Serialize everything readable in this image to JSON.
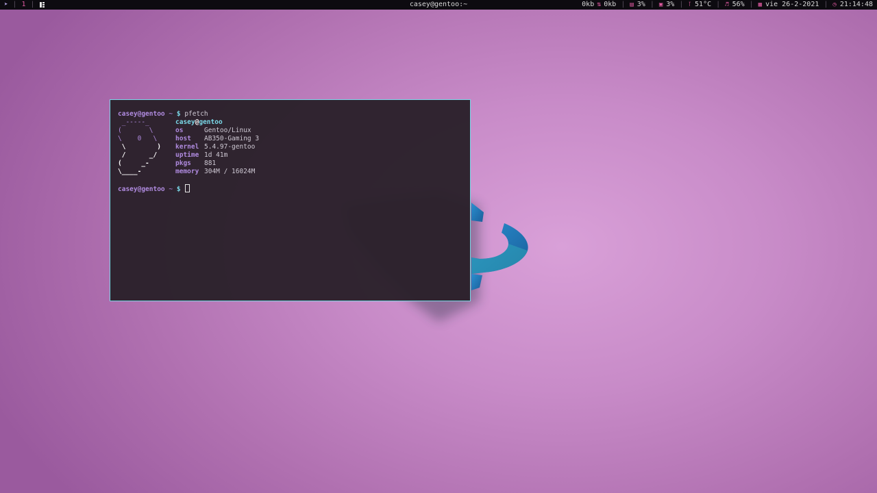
{
  "topbar": {
    "workspace": "1",
    "window_title": "casey@gentoo:~",
    "net_down": "0kb",
    "net_up": "0kb",
    "mem": "3%",
    "cpu": "3%",
    "temp": "51°C",
    "volume": "56%",
    "date": "vie 26-2-2021",
    "time": "21:14:48"
  },
  "terminal": {
    "prompt_user": "casey@gentoo",
    "prompt_dir": "~",
    "prompt_symbol": "$",
    "command": "pfetch",
    "title_user": "casey",
    "title_at": "@",
    "title_host": "gentoo",
    "art": [
      " _-----_",
      "(       \\",
      "\\    0   \\",
      " \\        )",
      " /      _/",
      "(     _-",
      "\\____-"
    ],
    "info": [
      {
        "label": "os",
        "value": "Gentoo/Linux"
      },
      {
        "label": "host",
        "value": "AB350-Gaming 3"
      },
      {
        "label": "kernel",
        "value": "5.4.97-gentoo"
      },
      {
        "label": "uptime",
        "value": "1d 41m"
      },
      {
        "label": "pkgs",
        "value": "881"
      },
      {
        "label": "memory",
        "value": "304M / 16024M"
      }
    ]
  },
  "colors": {
    "accent": "#e05aa0",
    "prompt": "#b08be0",
    "cyan": "#7ad8e8",
    "bar_bg": "#0d0b10",
    "terminal_bg": "#2a202a"
  }
}
